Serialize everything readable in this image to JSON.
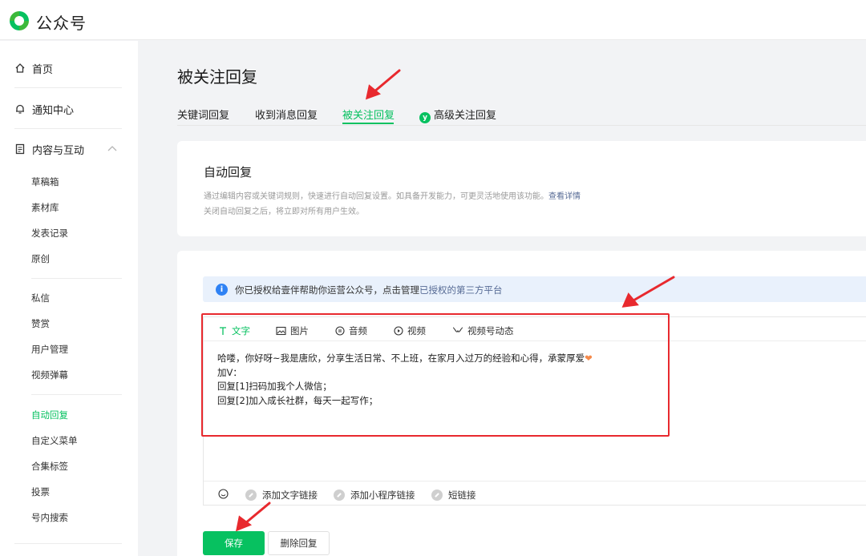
{
  "header": {
    "brand": "公众号"
  },
  "sidebar": {
    "home": "首页",
    "notifications": "通知中心",
    "content_group": "内容与互动",
    "items": [
      "草稿箱",
      "素材库",
      "发表记录",
      "原创",
      "私信",
      "赞赏",
      "用户管理",
      "视频弹幕",
      "自动回复",
      "自定义菜单",
      "合集标签",
      "投票",
      "号内搜索"
    ],
    "active_item": "自动回复"
  },
  "page": {
    "title": "被关注回复",
    "tabs": [
      "关键词回复",
      "收到消息回复",
      "被关注回复",
      "高级关注回复"
    ],
    "active_tab": "被关注回复"
  },
  "intro": {
    "title": "自动回复",
    "desc1": "通过编辑内容或关键词规则，快速进行自动回复设置。如具备开发能力，可更灵活地使用该功能。",
    "desc1_link": "查看详情",
    "desc2": "关闭自动回复之后，将立即对所有用户生效。"
  },
  "notice": {
    "text": "你已授权给壹伴帮助你运营公众号，点击管理",
    "link": "已授权的第三方平台"
  },
  "editor": {
    "types": [
      "文字",
      "图片",
      "音频",
      "视频",
      "视频号动态"
    ],
    "active_type": "文字",
    "content_lines": [
      "哈喽，你好呀~我是唐欣，分享生活日常、不上班，在家月入过万的经验和心得，承蒙厚爱",
      "加V：",
      "回复[1]扫码加我个人微信；",
      "回复[2]加入成长社群，每天一起写作；"
    ],
    "content_heart": "❤",
    "footer_links": [
      "添加文字链接",
      "添加小程序链接",
      "短链接"
    ]
  },
  "actions": {
    "save": "保存",
    "delete": "删除回复"
  },
  "colors": {
    "accent": "#07c160",
    "annotation": "#e8292e",
    "info": "#2f82f4"
  }
}
